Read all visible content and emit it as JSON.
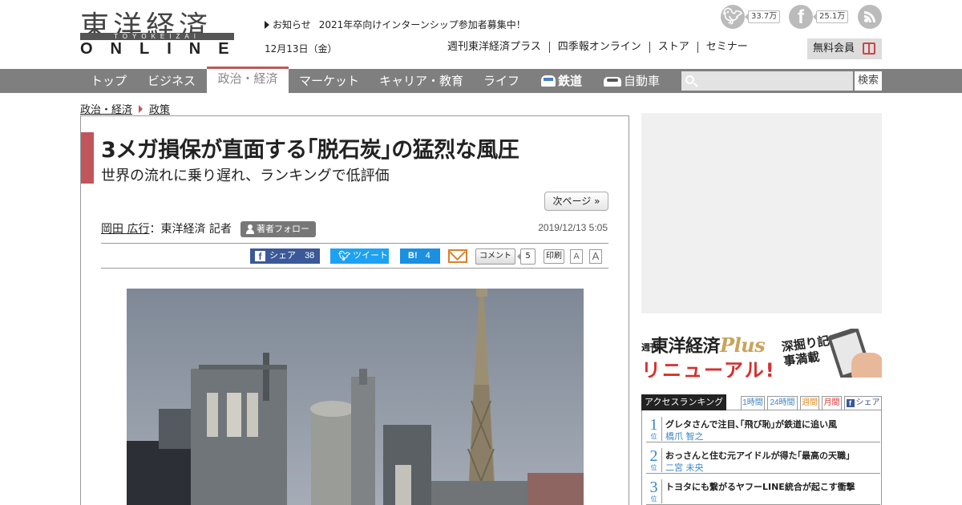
{
  "logo": {
    "kanji": "東洋経済",
    "romaji": "TOYOKEIZAI",
    "online": "ONLINE"
  },
  "header": {
    "notice_label": "お知らせ",
    "notice_text": "2021年卒向けインターンシップ参加者募集中！",
    "date": "12月13日（金）",
    "links": [
      "週刊東洋経済プラス",
      "四季報オンライン",
      "ストア",
      "セミナー"
    ],
    "member_label": "無料会員",
    "social": {
      "twitter_count": "33.7万",
      "facebook_count": "25.1万"
    }
  },
  "nav": {
    "items": [
      "トップ",
      "ビジネス",
      "政治・経済",
      "マーケット",
      "キャリア・教育",
      "ライフ",
      "鉄道",
      "自動車"
    ],
    "active": "政治・経済",
    "search_placeholder": "",
    "search_button": "検索"
  },
  "breadcrumb": [
    "政治・経済",
    "政策"
  ],
  "article": {
    "title": "3メガ損保が直面する｢脱石炭｣の猛烈な風圧",
    "subtitle": "世界の流れに乗り遅れ、ランキングで低評価",
    "next_page": "次ページ »",
    "author": "岡田 広行",
    "author_affiliation": "：東洋経済 記者",
    "follow_label": "著者フォロー",
    "published": "2019/12/13 5:05",
    "share": {
      "facebook_label": "シェア",
      "facebook_count": "38",
      "tweet_label": "ツイート",
      "hatena_label": "B!",
      "hatena_count": "4",
      "comment_label": "コメント",
      "comment_count": "5",
      "print_label": "印刷",
      "font_small": "A",
      "font_large": "A"
    }
  },
  "sidebar": {
    "banner": {
      "small": "週刊",
      "brand": "東洋経済",
      "plus": "Plus",
      "renewal": "リニューアル!",
      "tagline": "深掘り記事満載"
    },
    "ranking": {
      "title": "アクセスランキング",
      "tabs": [
        "1時間",
        "24時間",
        "週間",
        "月間",
        "シェア"
      ],
      "rank_suffix": "位",
      "items": [
        {
          "rank": "1",
          "title": "グレタさんで注目､｢飛び恥｣が鉄道に追い風",
          "author": "橋爪 智之"
        },
        {
          "rank": "2",
          "title": "おっさんと住む元アイドルが得た｢最高の天職｣",
          "author": "二宮 未央"
        },
        {
          "rank": "3",
          "title": "トヨタにも繋がるヤフーLINE統合が起こす衝撃",
          "author": ""
        }
      ]
    }
  },
  "colors": {
    "accent": "#c0565b",
    "nav_bg": "#7f7f7f",
    "facebook": "#3b5998",
    "twitter": "#1da1f2",
    "hatena": "#1b8fe0",
    "link_blue": "#3a86c8"
  }
}
